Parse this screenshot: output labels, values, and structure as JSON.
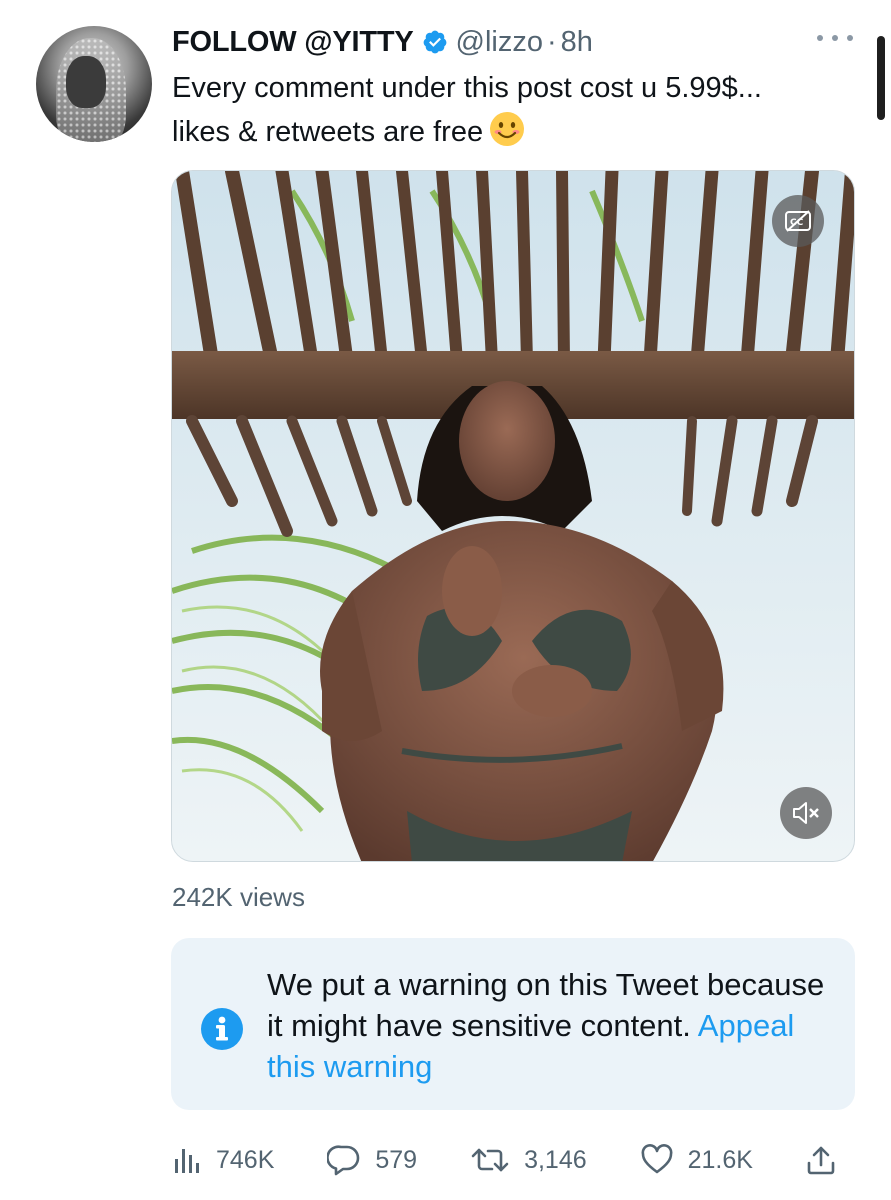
{
  "tweet": {
    "display_name": "FOLLOW @YITTY",
    "handle": "@lizzo",
    "separator": "·",
    "time": "8h",
    "text": "Every comment under this post cost u 5.99$... likes & retweets are free",
    "emoji": "smiling-face-icon"
  },
  "media": {
    "type": "video",
    "views": "242K views"
  },
  "warning": {
    "message": "We put a warning on this Tweet because it might have sensitive content.",
    "appeal_label": "Appeal this warning"
  },
  "actions": {
    "views_count": "746K",
    "replies_count": "579",
    "retweets_count": "3,146",
    "likes_count": "21.6K"
  },
  "colors": {
    "accent": "#1d9bf0",
    "secondary_text": "#536471",
    "warning_bg": "#ebf3f9"
  }
}
